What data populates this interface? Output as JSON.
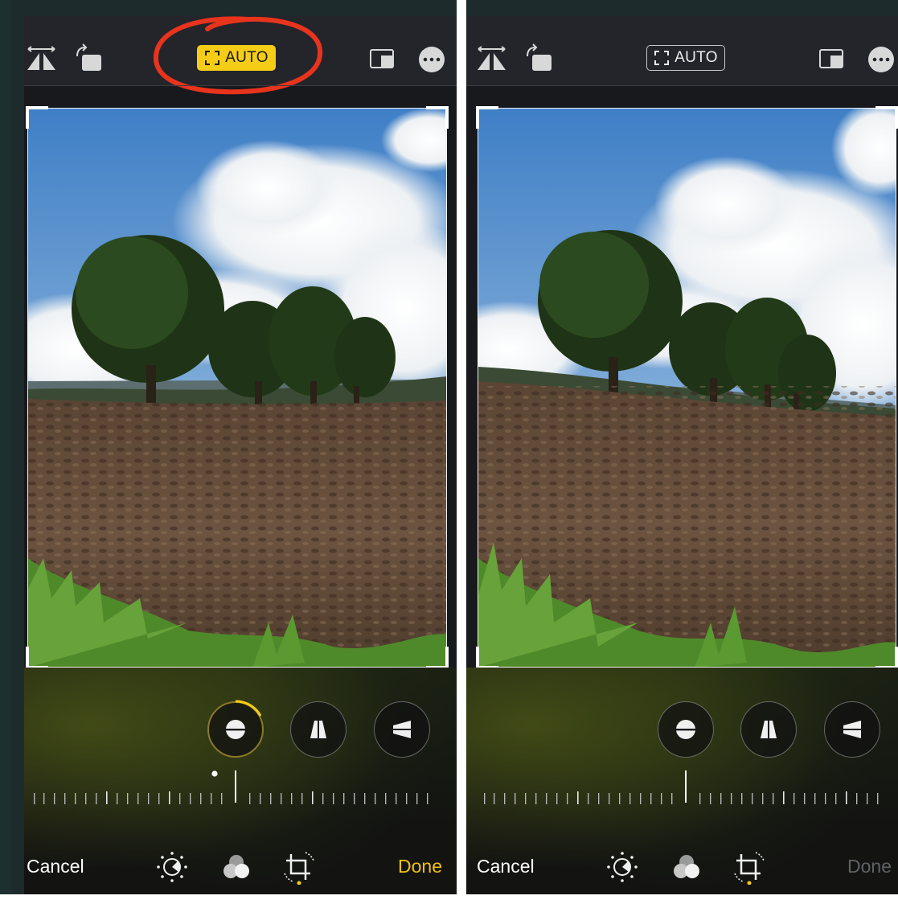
{
  "colors": {
    "accent_yellow": "#f6cd16",
    "done_active": "#f2c20e",
    "done_inactive": "#5f6165",
    "annotation_red": "#e8341c",
    "toolbar_bg": "#23252b"
  },
  "panels": [
    {
      "state": "auto-straighten-on",
      "toolbar": {
        "flip_icon": "flip-horizontal-icon",
        "rotate_icon": "rotate-icon",
        "auto_label": "AUTO",
        "auto_active": true,
        "aspect_icon": "aspect-ratio-icon",
        "more_icon": "more-icon"
      },
      "modes": [
        "straighten-icon",
        "vertical-perspective-icon",
        "horizontal-perspective-icon"
      ],
      "active_mode": "straighten",
      "straighten_adjusted": true,
      "bottom": {
        "cancel_label": "Cancel",
        "done_label": "Done",
        "done_enabled": true
      }
    },
    {
      "state": "auto-straighten-off",
      "toolbar": {
        "flip_icon": "flip-horizontal-icon",
        "rotate_icon": "rotate-icon",
        "auto_label": "AUTO",
        "auto_active": false,
        "aspect_icon": "aspect-ratio-icon",
        "more_icon": "more-icon"
      },
      "modes": [
        "straighten-icon",
        "vertical-perspective-icon",
        "horizontal-perspective-icon"
      ],
      "active_mode": "none",
      "straighten_adjusted": false,
      "bottom": {
        "cancel_label": "Cancel",
        "done_label": "Done",
        "done_enabled": false
      }
    }
  ]
}
